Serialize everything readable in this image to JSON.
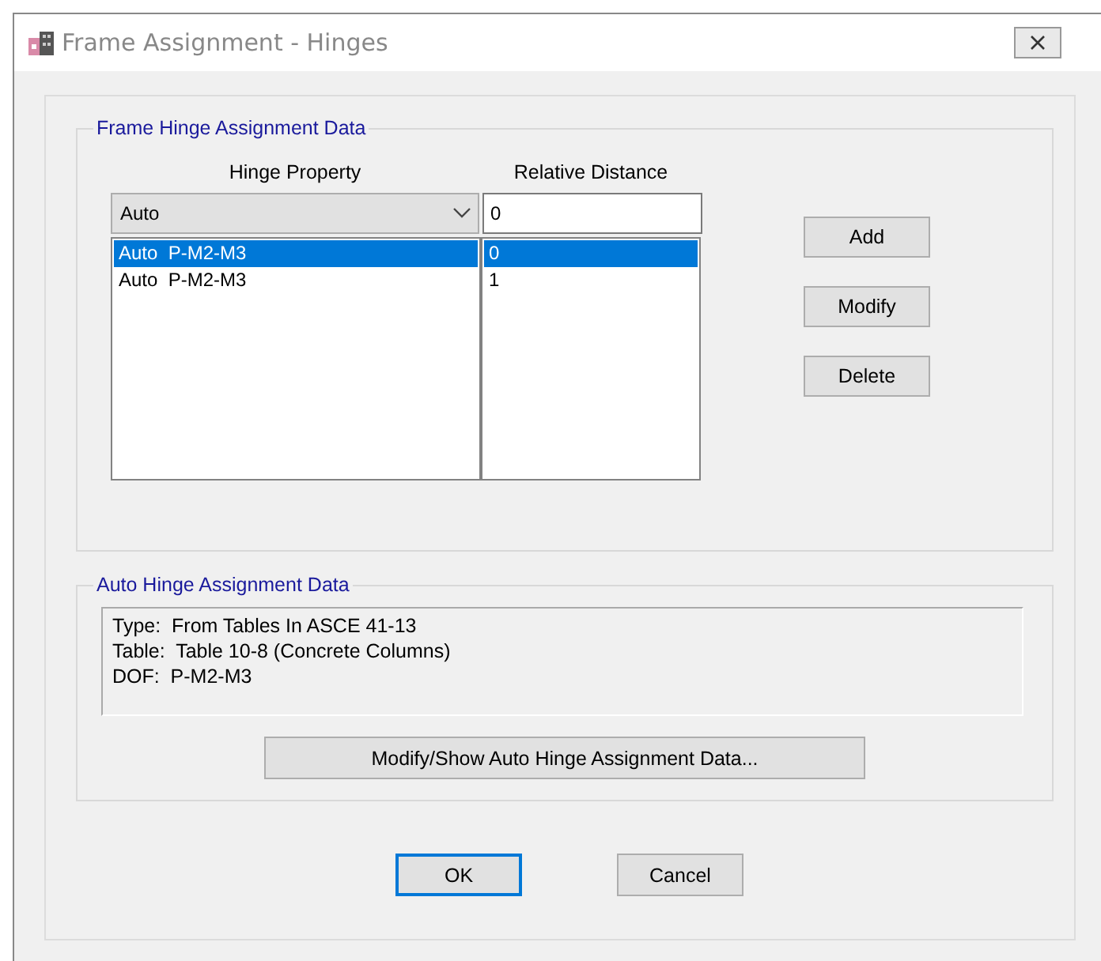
{
  "window": {
    "title": "Frame Assignment - Hinges"
  },
  "frame_hinge_group": {
    "legend": "Frame Hinge Assignment Data",
    "hinge_property_label": "Hinge Property",
    "relative_distance_label": "Relative Distance",
    "hinge_property_select": "Auto",
    "relative_distance_input": "0",
    "rows": [
      {
        "hinge_property": "Auto  P-M2-M3",
        "relative_distance": "0",
        "selected": true
      },
      {
        "hinge_property": "Auto  P-M2-M3",
        "relative_distance": "1",
        "selected": false
      }
    ],
    "buttons": [
      "Add",
      "Modify",
      "Delete"
    ]
  },
  "auto_hinge_group": {
    "legend": "Auto Hinge Assignment Data",
    "lines": [
      "Type:  From Tables In ASCE 41-13",
      "Table:  Table 10-8 (Concrete Columns)",
      "DOF:  P-M2-M3"
    ],
    "button": "Modify/Show Auto Hinge Assignment Data..."
  },
  "dialog_buttons": [
    {
      "label": "OK",
      "default": true
    },
    {
      "label": "Cancel",
      "default": false
    }
  ]
}
